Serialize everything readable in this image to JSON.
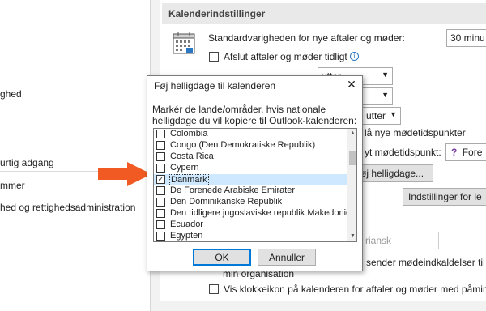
{
  "left_nav": {
    "items": [
      {
        "label": "ghed"
      },
      {
        "label": "urtig adgang"
      },
      {
        "label": "mmer"
      },
      {
        "label": "hed og rettighedsadministration"
      }
    ]
  },
  "calendar_settings": {
    "section_title": "Kalenderindstillinger",
    "default_duration_label": "Standardvarigheden for nye aftaler og møder:",
    "default_duration_value": "30 minu",
    "end_early_label": "Afslut aftaler og møder tidligt",
    "row3_combo": "utter",
    "row4_combo": "utter",
    "row5_combo": "utter",
    "new_meeting_times_text": "lå nye mødetidspunkter",
    "new_meeting_time_label": "yt mødetidspunkt:",
    "new_meeting_time_value": "Fore",
    "add_holidays_button": "øj helligdage...",
    "settings_for_button": "Indstillinger for le",
    "language_combo": "riansk",
    "send_invites_text": "sender mødeindkaldelser til p",
    "my_org_text": "min organisation",
    "show_weather_label": "Vis klokkeikon på kalenderen for aftaler og møder med påmin"
  },
  "dialog": {
    "title": "Føj helligdage til kalenderen",
    "close_glyph": "✕",
    "instruction": "Markér de lande/områder, hvis nationale helligdage du vil kopiere til Outlook-kalenderen:",
    "countries": [
      {
        "name": "Colombia",
        "checked": false,
        "selected": false
      },
      {
        "name": "Congo (Den Demokratiske Republik)",
        "checked": false,
        "selected": false
      },
      {
        "name": "Costa Rica",
        "checked": false,
        "selected": false
      },
      {
        "name": "Cypern",
        "checked": false,
        "selected": false
      },
      {
        "name": "Danmark",
        "checked": true,
        "selected": true
      },
      {
        "name": "De Forenede Arabiske Emirater",
        "checked": false,
        "selected": false
      },
      {
        "name": "Den Dominikanske Republik",
        "checked": false,
        "selected": false
      },
      {
        "name": "Den tidligere jugoslaviske republik Makedonien",
        "checked": false,
        "selected": false
      },
      {
        "name": "Ecuador",
        "checked": false,
        "selected": false
      },
      {
        "name": "Egypten",
        "checked": false,
        "selected": false
      }
    ],
    "ok_label": "OK",
    "cancel_label": "Annuller"
  },
  "arrow_color": "#f15a22",
  "accent_color": "#0078d7"
}
